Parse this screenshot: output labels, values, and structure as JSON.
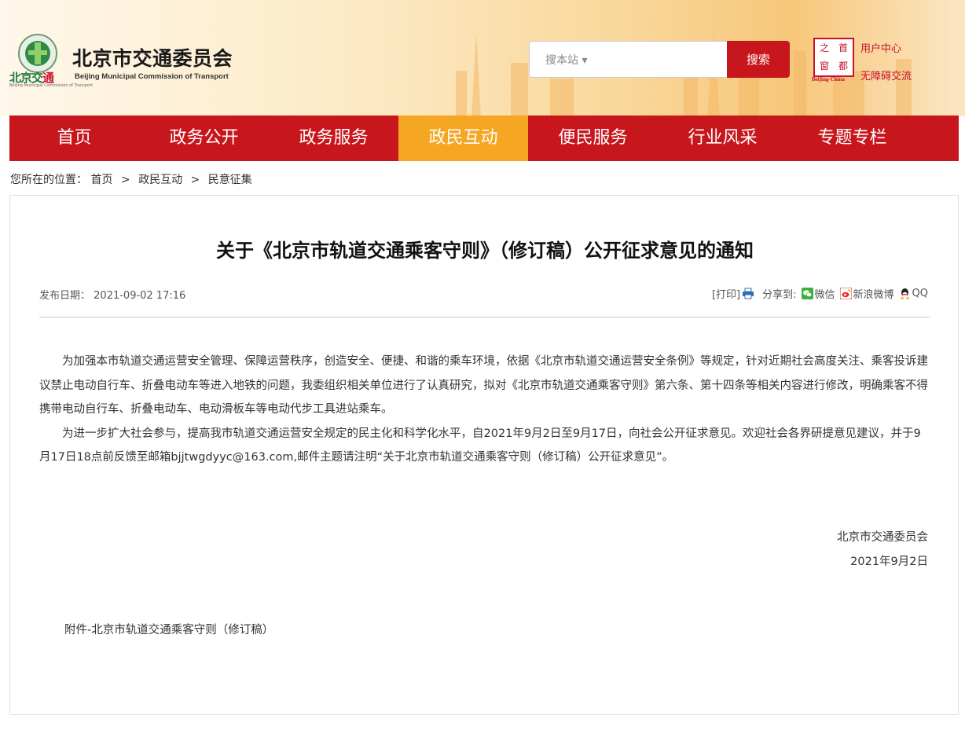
{
  "header": {
    "logo_cn_part1": "北京交",
    "logo_cn_part2": "通",
    "logo_cn_small": "Beijing Municipal Commission of Transport",
    "site_title": "北京市交通委员会",
    "site_title_en": "Beijing Municipal Commission of Transport",
    "search_placeholder": "搜本站 ▾",
    "search_button": "搜索",
    "capital_logo_chars": [
      "首",
      "之",
      "都",
      "窗"
    ],
    "capital_en": "Beijing-China",
    "user_center": "用户中心",
    "accessible": "无障碍交流"
  },
  "nav": {
    "items": [
      "首页",
      "政务公开",
      "政务服务",
      "政民互动",
      "便民服务",
      "行业风采",
      "专题专栏"
    ],
    "active_index": 3
  },
  "breadcrumb": {
    "prefix": "您所在的位置：",
    "items": [
      "首页",
      "政民互动",
      "民意征集"
    ],
    "separator": ">"
  },
  "article": {
    "title": "关于《北京市轨道交通乘客守则》（修订稿）公开征求意见的通知",
    "pub_date_label": "发布日期：",
    "pub_date": "2021-09-02 17:16",
    "print_label": "[打印]",
    "share_label": "分享到:",
    "share_wechat": "微信",
    "share_weibo": "新浪微博",
    "share_qq": "QQ",
    "paragraphs": [
      "为加强本市轨道交通运营安全管理、保障运营秩序，创造安全、便捷、和谐的乘车环境，依据《北京市轨道交通运营安全条例》等规定，针对近期社会高度关注、乘客投诉建议禁止电动自行车、折叠电动车等进入地铁的问题，我委组织相关单位进行了认真研究，拟对《北京市轨道交通乘客守则》第六条、第十四条等相关内容进行修改，明确乘客不得携带电动自行车、折叠电动车、电动滑板车等电动代步工具进站乘车。",
      "为进一步扩大社会参与，提高我市轨道交通运营安全规定的民主化和科学化水平，自2021年9月2日至9月17日，向社会公开征求意见。欢迎社会各界研提意见建议，并于9月17日18点前反馈至邮箱bjjtwgdyyc@163.com,邮件主题请注明“关于北京市轨道交通乘客守则（修订稿）公开征求意见”。"
    ],
    "signature_org": "北京市交通委员会",
    "signature_date": "2021年9月2日",
    "attachment": "附件-北京市轨道交通乘客守则（修订稿）"
  },
  "colors": {
    "brand_red": "#c8161d",
    "active_orange": "#f5a623"
  }
}
